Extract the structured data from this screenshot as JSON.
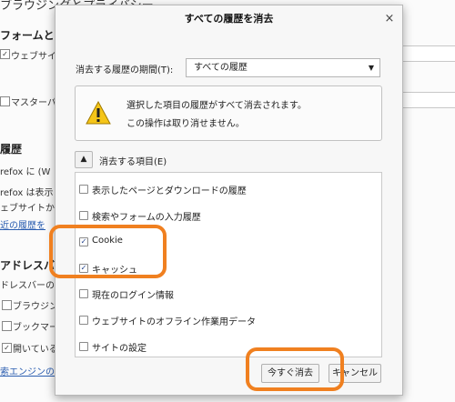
{
  "background": {
    "page_title": "ブラウジングとプライバシー",
    "section_forms": "フォームとパ",
    "website_checkbox_label": "ウェブサイ",
    "master_label": "マスターパ",
    "history_heading": "履歴",
    "firefox_line1": "refox に (W",
    "firefox_line2": "refox は表示",
    "website_line": "ェブサイトか",
    "recent_history_link": "近の履歴を",
    "address_bar_heading": "アドレスバー",
    "address_bar_desc": "ドレスバーの",
    "browsing_label": "ブラウジン",
    "bookmark_label": "ブックマー",
    "open_label": "開いている",
    "search_engine_link": "索エンジンの"
  },
  "dialog": {
    "title": "すべての履歴を消去",
    "close_symbol": "×",
    "period_label": "消去する履歴の期間(T):",
    "period_value": "すべての履歴",
    "warning_line1": "選択した項目の履歴がすべて消去されます。",
    "warning_line2": "この操作は取り消せません。",
    "section_label": "消去する項目(E)",
    "items": [
      {
        "label": "表示したページとダウンロードの履歴",
        "checked": false
      },
      {
        "label": "検索やフォームの入力履歴",
        "checked": false
      },
      {
        "label": "Cookie",
        "checked": true
      },
      {
        "label": "キャッシュ",
        "checked": true
      },
      {
        "label": "現在のログイン情報",
        "checked": false
      },
      {
        "label": "ウェブサイトのオフライン作業用データ",
        "checked": false
      },
      {
        "label": "サイトの設定",
        "checked": false
      }
    ],
    "clear_now_button": "今すぐ消去",
    "cancel_button": "キャンセル"
  },
  "colors": {
    "highlight": "#f08020",
    "warning_icon": "#f5c518"
  },
  "icons": {
    "warning": "warning-triangle-icon",
    "close": "close-icon",
    "expand": "chevron-up-icon",
    "dropdown": "chevron-down-icon"
  }
}
